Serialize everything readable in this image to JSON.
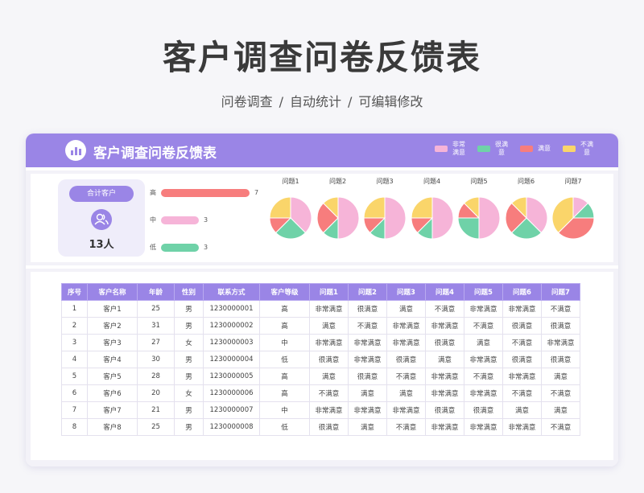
{
  "title": "客户调查问卷反馈表",
  "subtitle": [
    "问卷调查",
    "/",
    "自动统计",
    "/",
    "可编辑修改"
  ],
  "card": {
    "title": "客户调查问卷反馈表",
    "legend": [
      {
        "label": "非常满意",
        "color": "#f6b4d8"
      },
      {
        "label": "很满意",
        "color": "#6fd2a8"
      },
      {
        "label": "满意",
        "color": "#f77d7d"
      },
      {
        "label": "不满意",
        "color": "#fad56a"
      }
    ]
  },
  "summary": {
    "total_label": "合计客户",
    "total_count": "13人",
    "levels": [
      {
        "label": "高",
        "value": 7,
        "color": "#f77d7d"
      },
      {
        "label": "中",
        "value": 3,
        "color": "#f6b4d8"
      },
      {
        "label": "低",
        "value": 3,
        "color": "#6fd2a8"
      }
    ],
    "level_max": 7
  },
  "chart_data": {
    "type": "pie",
    "categories": [
      "非常满意",
      "很满意",
      "满意",
      "不满意"
    ],
    "colors": [
      "#f6b4d8",
      "#6fd2a8",
      "#f77d7d",
      "#fad56a"
    ],
    "pies": [
      {
        "title": "问题1",
        "values": [
          3,
          2,
          1,
          2
        ]
      },
      {
        "title": "问题2",
        "values": [
          4,
          1,
          2,
          1
        ]
      },
      {
        "title": "问题3",
        "values": [
          4,
          1,
          1,
          2
        ]
      },
      {
        "title": "问题4",
        "values": [
          4,
          1,
          1,
          2
        ]
      },
      {
        "title": "问题5",
        "values": [
          4,
          2,
          1,
          1
        ]
      },
      {
        "title": "问题6",
        "values": [
          3,
          2,
          2,
          1
        ]
      },
      {
        "title": "问题7",
        "values": [
          1,
          1,
          3,
          3
        ]
      }
    ]
  },
  "table": {
    "headers": [
      "序号",
      "客户名称",
      "年龄",
      "性别",
      "联系方式",
      "客户等级",
      "问题1",
      "问题2",
      "问题3",
      "问题4",
      "问题5",
      "问题6",
      "问题7"
    ],
    "rows": [
      [
        "1",
        "客户1",
        "25",
        "男",
        "1230000001",
        "高",
        "非常满意",
        "很满意",
        "满意",
        "不满意",
        "非常满意",
        "非常满意",
        "不满意"
      ],
      [
        "2",
        "客户2",
        "31",
        "男",
        "1230000002",
        "高",
        "满意",
        "不满意",
        "非常满意",
        "非常满意",
        "不满意",
        "很满意",
        "很满意"
      ],
      [
        "3",
        "客户3",
        "27",
        "女",
        "1230000003",
        "中",
        "非常满意",
        "非常满意",
        "非常满意",
        "很满意",
        "满意",
        "不满意",
        "非常满意"
      ],
      [
        "4",
        "客户4",
        "30",
        "男",
        "1230000004",
        "低",
        "很满意",
        "非常满意",
        "很满意",
        "满意",
        "非常满意",
        "很满意",
        "很满意"
      ],
      [
        "5",
        "客户5",
        "28",
        "男",
        "1230000005",
        "高",
        "满意",
        "很满意",
        "不满意",
        "非常满意",
        "不满意",
        "非常满意",
        "满意"
      ],
      [
        "6",
        "客户6",
        "20",
        "女",
        "1230000006",
        "高",
        "不满意",
        "满意",
        "满意",
        "非常满意",
        "非常满意",
        "不满意",
        "不满意"
      ],
      [
        "7",
        "客户7",
        "21",
        "男",
        "1230000007",
        "中",
        "非常满意",
        "非常满意",
        "非常满意",
        "很满意",
        "很满意",
        "满意",
        "满意"
      ],
      [
        "8",
        "客户8",
        "25",
        "男",
        "1230000008",
        "低",
        "很满意",
        "满意",
        "不满意",
        "非常满意",
        "非常满意",
        "非常满意",
        "不满意"
      ]
    ]
  }
}
